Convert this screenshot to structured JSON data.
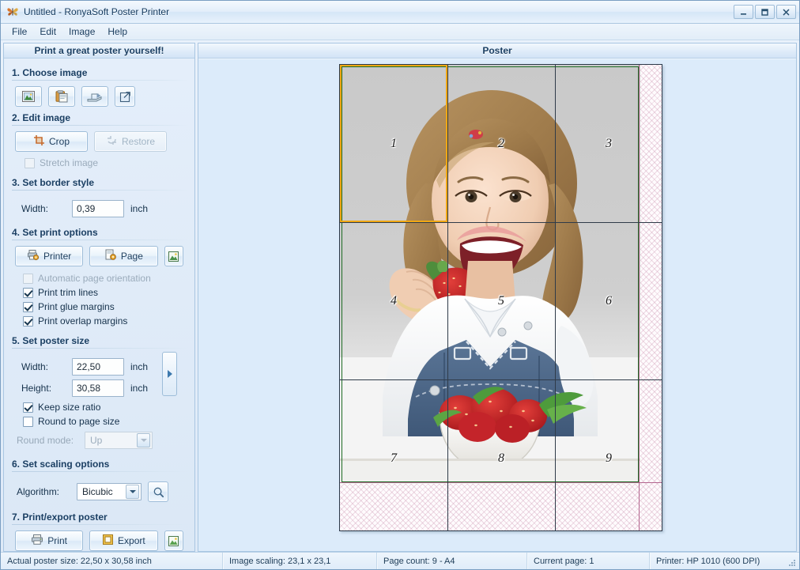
{
  "window": {
    "title": "Untitled - RonyaSoft Poster Printer",
    "icon": "butterfly-app-icon",
    "buttons": {
      "minimize": "minimize-icon",
      "maximize": "maximize-icon",
      "close": "close-icon"
    }
  },
  "menu": {
    "items": [
      "File",
      "Edit",
      "Image",
      "Help"
    ]
  },
  "sidebar": {
    "header": "Print a great poster yourself!",
    "sections": [
      {
        "title": "1. Choose image",
        "buttons": [
          {
            "name": "open-image-button",
            "icon": "picture-icon"
          },
          {
            "name": "paste-image-button",
            "icon": "clipboard-icon"
          },
          {
            "name": "scan-image-button",
            "icon": "scanner-icon"
          },
          {
            "name": "image-source-options-button",
            "icon": "external-link-icon"
          }
        ]
      },
      {
        "title": "2. Edit image",
        "crop_label": "Crop",
        "restore_label": "Restore",
        "stretch_label": "Stretch image"
      },
      {
        "title": "3. Set border style",
        "width_label": "Width:",
        "width_value": "0,39",
        "width_unit": "inch"
      },
      {
        "title": "4. Set print options",
        "printer_label": "Printer",
        "page_label": "Page",
        "checkboxes": [
          {
            "label": "Automatic page orientation",
            "checked": false,
            "enabled": false
          },
          {
            "label": "Print trim lines",
            "checked": true,
            "enabled": true
          },
          {
            "label": "Print glue margins",
            "checked": true,
            "enabled": true
          },
          {
            "label": "Print overlap margins",
            "checked": true,
            "enabled": true
          }
        ]
      },
      {
        "title": "5. Set poster size",
        "width_label": "Width:",
        "width_value": "22,50",
        "width_unit": "inch",
        "height_label": "Height:",
        "height_value": "30,58",
        "height_unit": "inch",
        "keep_ratio_label": "Keep size ratio",
        "keep_ratio_checked": true,
        "round_page_label": "Round to page size",
        "round_page_checked": false,
        "round_mode_label": "Round mode:",
        "round_mode_value": "Up"
      },
      {
        "title": "6. Set scaling options",
        "algorithm_label": "Algorithm:",
        "algorithm_value": "Bicubic"
      },
      {
        "title": "7. Print/export poster",
        "print_label": "Print",
        "export_label": "Export"
      }
    ]
  },
  "poster": {
    "header": "Poster",
    "columns": 3,
    "rows": 3,
    "page_numbers": [
      "1",
      "2",
      "3",
      "4",
      "5",
      "6",
      "7",
      "8",
      "9"
    ],
    "selected_page": "1",
    "colors": {
      "selection": "#f0a713",
      "glue_margin": "#1d6b23",
      "overlap_margin": "#9c3a6e",
      "page_grid": "#2f3b49"
    }
  },
  "status": {
    "poster_size": "Actual poster size: 22,50 x 30,58 inch",
    "image_scaling": "Image scaling: 23,1 x 23,1",
    "page_count": "Page count: 9 - A4",
    "current_page": "Current page: 1",
    "printer": "Printer: HP 1010 (600 DPI)"
  }
}
